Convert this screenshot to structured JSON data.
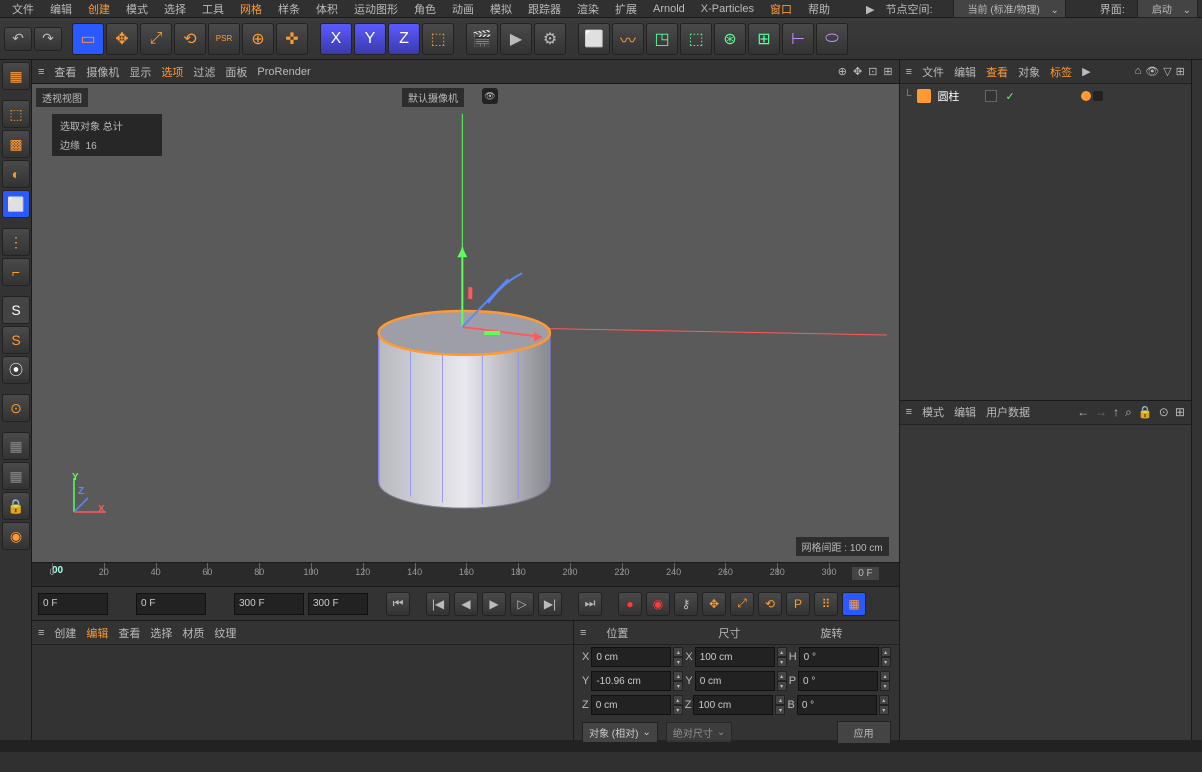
{
  "menu": {
    "items": [
      "文件",
      "编辑",
      "创建",
      "模式",
      "选择",
      "工具",
      "网格",
      "样条",
      "体积",
      "运动图形",
      "角色",
      "动画",
      "模拟",
      "跟踪器",
      "渲染",
      "扩展",
      "Arnold",
      "X-Particles",
      "窗口",
      "帮助"
    ],
    "nodeSpace": "节点空间:",
    "current": "当前 (标准/物理)",
    "interface": "界面:",
    "layout": "启动"
  },
  "vp": {
    "menus": [
      "查看",
      "摄像机",
      "显示",
      "选项",
      "过滤",
      "面板",
      "ProRender"
    ],
    "persp": "透视视图",
    "camera": "默认摄像机",
    "sel_title": "选取对象 总计",
    "edges_label": "边缘",
    "edges": "16",
    "grid": "网格间距 : 100 cm"
  },
  "nav": {
    "y": "Y",
    "z": "Z",
    "x": "X"
  },
  "timeline": {
    "ticks": [
      "0",
      "20",
      "40",
      "60",
      "80",
      "100",
      "120",
      "140",
      "160",
      "180",
      "200",
      "220",
      "240",
      "260",
      "280",
      "300"
    ],
    "start": "0 F",
    "start2": "0 F",
    "end": "300 F",
    "end2": "300 F",
    "cur": "00",
    "endlabel": "0 F"
  },
  "bot": {
    "tabs": [
      "创建",
      "编辑",
      "查看",
      "选择",
      "材质",
      "纹理"
    ]
  },
  "coord": {
    "heads": [
      "位置",
      "尺寸",
      "旋转"
    ],
    "rows": [
      {
        "ax": "X",
        "p": "0 cm",
        "s": "100 cm",
        "r": "H",
        "rv": "0 °"
      },
      {
        "ax": "Y",
        "p": "-10.96 cm",
        "s": "0 cm",
        "r": "P",
        "rv": "0 °"
      },
      {
        "ax": "Z",
        "p": "0 cm",
        "s": "100 cm",
        "r": "B",
        "rv": "0 °"
      }
    ],
    "obj": "对象 (相对)",
    "abs": "绝对尺寸",
    "apply": "应用"
  },
  "obj": {
    "tabs": [
      "文件",
      "编辑",
      "查看",
      "对象",
      "标签"
    ],
    "node": "圆柱"
  },
  "attr": {
    "tabs": [
      "模式",
      "编辑",
      "用户数据"
    ]
  }
}
